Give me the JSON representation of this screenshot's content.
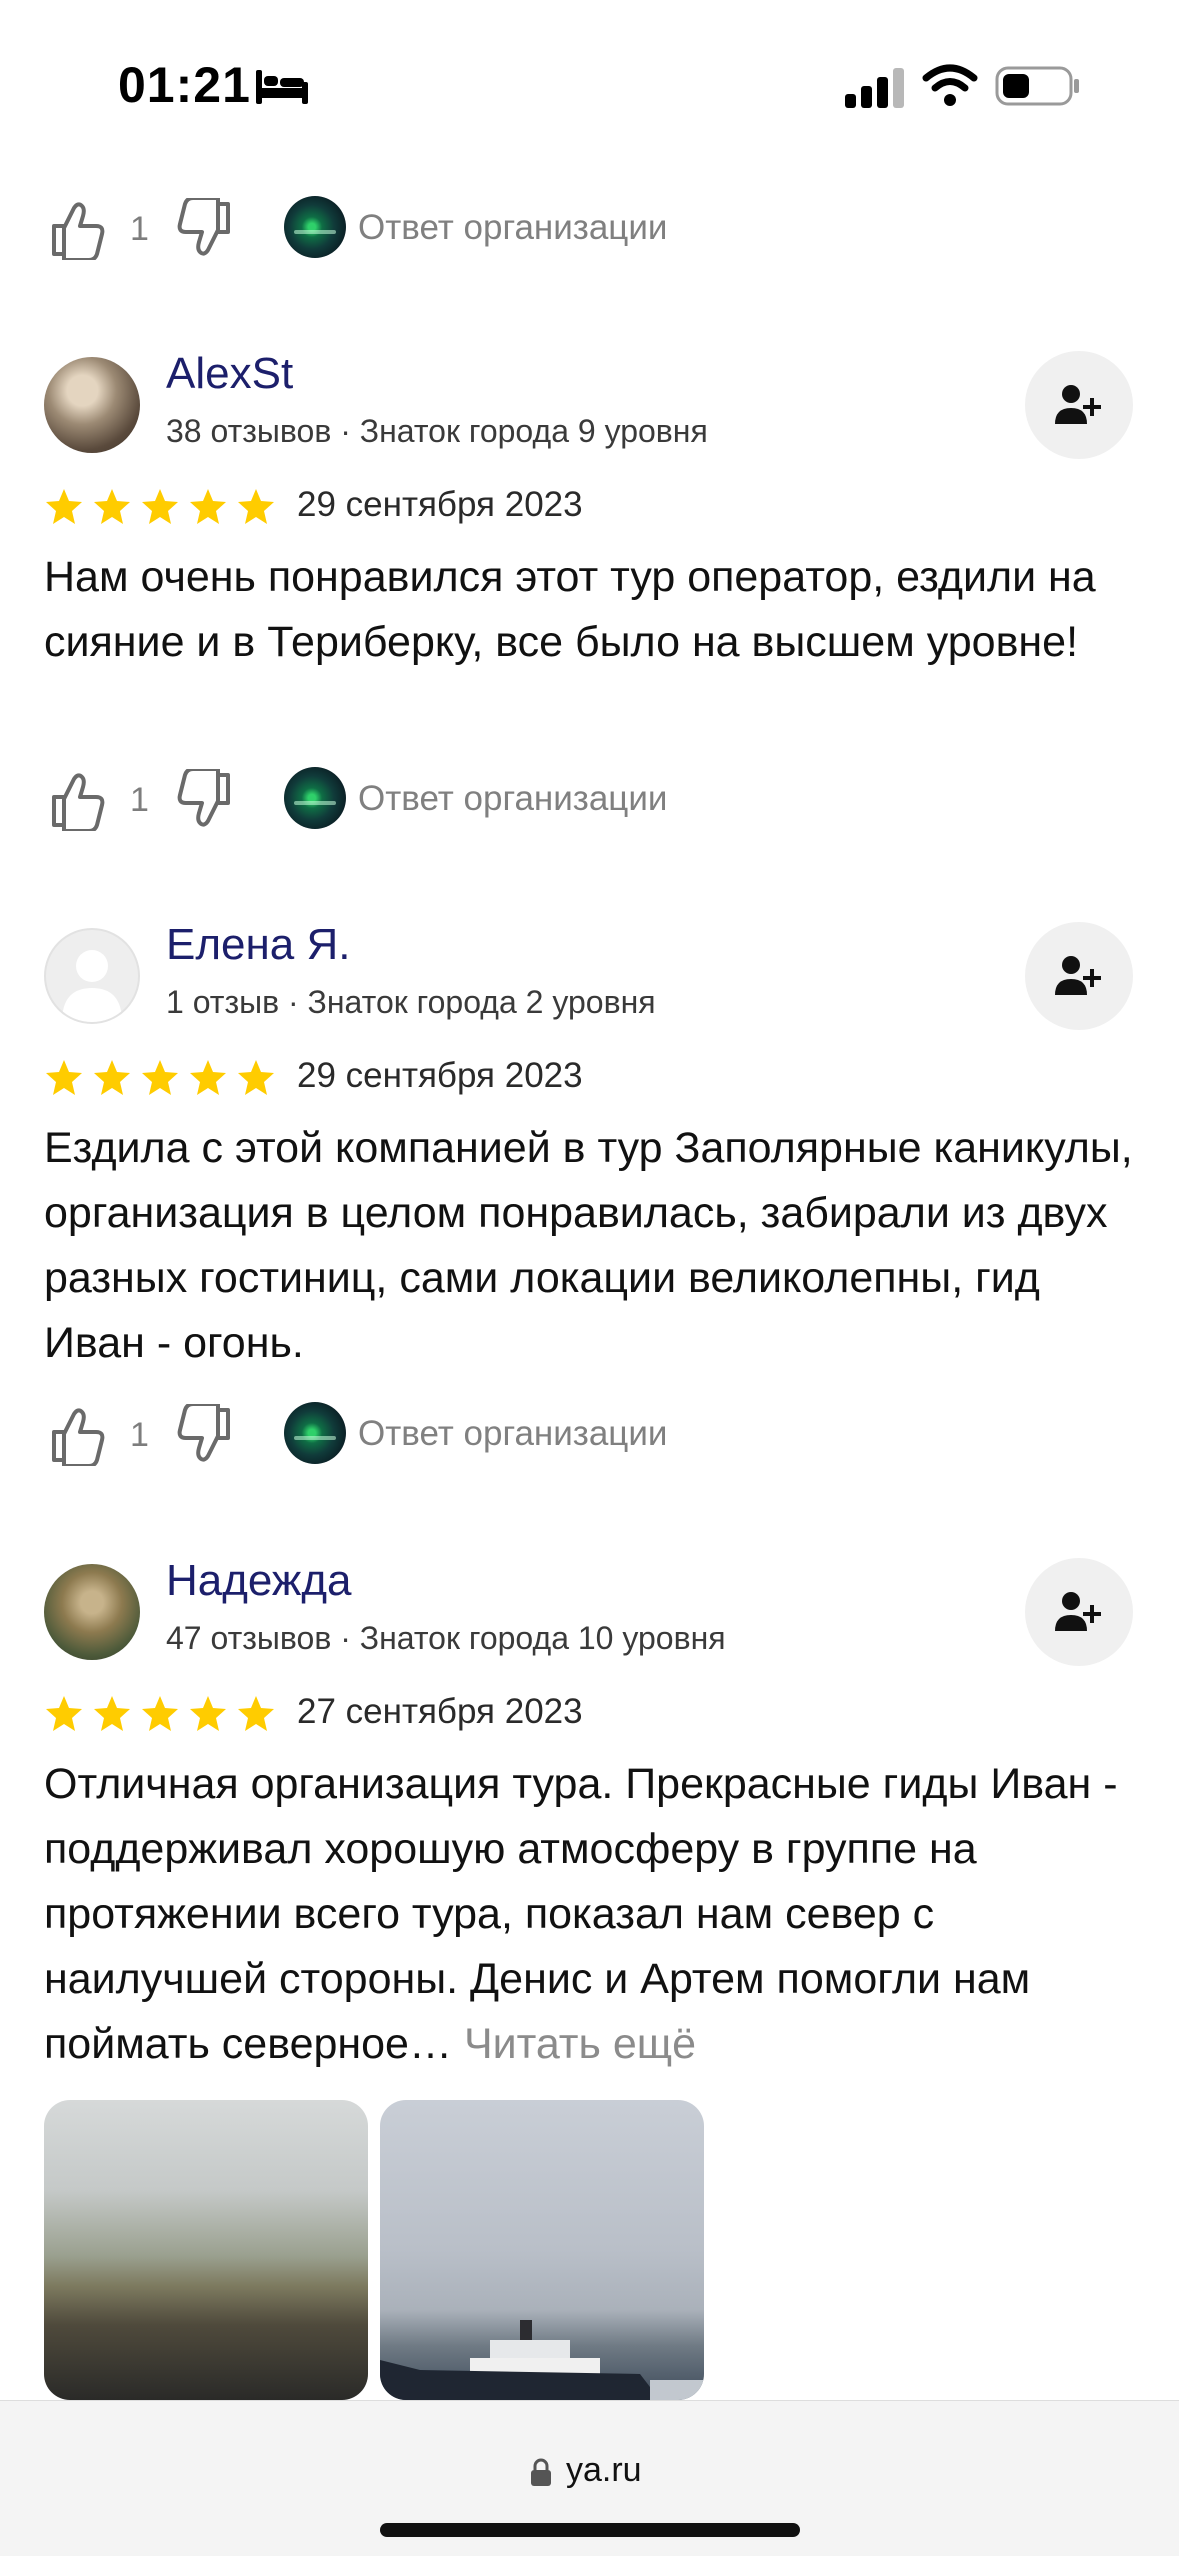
{
  "status_bar": {
    "time": "01:21",
    "icons": [
      "bed-icon",
      "signal-icon",
      "wifi-icon",
      "battery-icon"
    ]
  },
  "colors": {
    "author": "#1c1f6b",
    "star": "#ffcc00",
    "muted": "#808080"
  },
  "top_reactions": {
    "likes": "1",
    "org_reply": "Ответ организации"
  },
  "reviews": [
    {
      "author": "AlexSt",
      "meta": "38 отзывов · Знаток города 9 уровня",
      "rating": 5,
      "date": "29 сентября 2023",
      "text": "Нам очень понравился этот тур оператор, ездили на сияние и в Териберку, все было на высшем уровне!",
      "likes": "1",
      "org_reply": "Ответ организации"
    },
    {
      "author": "Елена Я.",
      "meta": "1 отзыв · Знаток города 2 уровня",
      "rating": 5,
      "date": "29 сентября 2023",
      "text": "Ездила с этой компанией в тур Заполярные каникулы, организация в целом понравилась, забирали из двух разных гостиниц, сами локации великолепны, гид Иван - огонь.",
      "likes": "1",
      "org_reply": "Ответ организации"
    },
    {
      "author": "Надежда",
      "meta": "47 отзывов · Знаток города 10 уровня",
      "rating": 5,
      "date": "27 сентября 2023",
      "text": "Отличная организация тура. Прекрасные гиды Иван - поддерживал хорошую атмосферу в группе на протяжении всего тура, показал нам север с наилучшей стороны. Денис и Артем помогли нам поймать северное…",
      "read_more": "Читать ещё"
    }
  ],
  "url_bar": {
    "url": "ya.ru"
  }
}
